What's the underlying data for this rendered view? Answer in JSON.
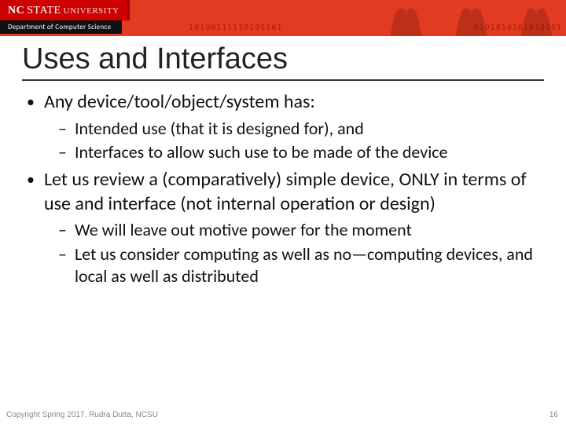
{
  "header": {
    "brand_nc": "NC",
    "brand_state": "STATE",
    "brand_univ": "UNIVERSITY",
    "department": "Department of Computer Science",
    "binary1": "10100111110101101",
    "binary2": "0101010101010101"
  },
  "slide": {
    "title": "Uses and Interfaces",
    "bullets": [
      {
        "text": "Any device/tool/object/system has:",
        "sub": [
          "Intended use (that it is designed for), and",
          "Interfaces to allow such use to be made of the device"
        ]
      },
      {
        "text": "Let us review a (comparatively) simple device, ONLY in terms of use and interface (not internal operation or design)",
        "sub": [
          "We will leave out motive power for the moment",
          "Let us consider computing as well as no—computing devices, and local as well as distributed"
        ]
      }
    ]
  },
  "footer": {
    "copyright": "Copyright Spring 2017, Rudra Dutta, NCSU",
    "page": "16"
  }
}
